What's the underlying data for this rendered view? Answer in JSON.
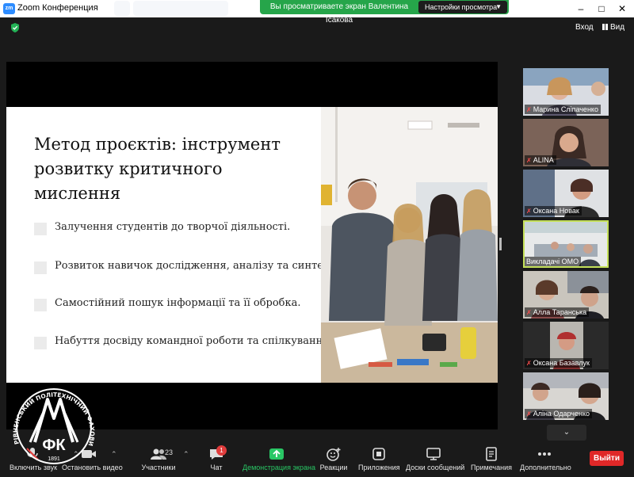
{
  "window": {
    "title": "Zoom Конференция",
    "app_icon": "zm",
    "controls": [
      "minimize-icon",
      "maximize-icon",
      "close-icon"
    ]
  },
  "share_banner": {
    "message": "Вы просматриваете экран Валентина Ісакова",
    "view_options": "Настройки просмотра",
    "color": "#26a54a"
  },
  "topbar": {
    "security_icon": "shield-check-icon",
    "enter_label": "Вход",
    "view_label": "Вид"
  },
  "slide": {
    "title": "Метод проєктів: інструмент розвитку критичного мислення",
    "bullets": [
      "Залучення студентів до творчої діяльності.",
      "Розвиток навичок дослідження, аналізу та синтезу.",
      "Самостійний пошук інформації та її обробка.",
      "Набуття досвіду командної роботи та спілкування."
    ]
  },
  "participants_gallery": [
    {
      "name": "Марина Сліпаченко",
      "muted": true
    },
    {
      "name": "ALINA",
      "muted": true
    },
    {
      "name": "Оксана Новак",
      "muted": true
    },
    {
      "name": "Викладачі ОМО",
      "muted": false,
      "active": true
    },
    {
      "name": "Алла Таранська",
      "muted": true
    },
    {
      "name": "Оксана Базавлук",
      "muted": true
    },
    {
      "name": "Аліна Одарченко",
      "muted": true
    }
  ],
  "toolbar": {
    "unmute_label": "Включить звук",
    "video_label": "Остановить видео",
    "participants_label": "Участники",
    "participants_count": "23",
    "chat_label": "Чат",
    "chat_badge": "1",
    "share_label": "Демонстрация экрана",
    "reactions_label": "Реакции",
    "apps_label": "Приложения",
    "whiteboards_label": "Доски сообщений",
    "notes_label": "Примечания",
    "more_label": "Дополнительно",
    "leave_label": "Выйти",
    "leave_color": "#e02828",
    "accent_green": "#29c765"
  },
  "watermark": {
    "arc_text": "РІВНЕНСЬКИЙ ПОЛІТЕХНІЧНИЙ ФАХОВИЙ КОЛЕДЖ",
    "initials": "ФК",
    "year": "1891"
  }
}
